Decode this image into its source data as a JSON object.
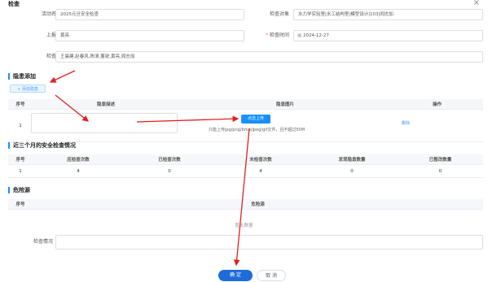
{
  "dialog": {
    "title": "检查",
    "close_icon": "×"
  },
  "form": {
    "activity_name_label": "活动名称",
    "activity_name_value": "2025元旦安全检查",
    "target_label": "检查对象",
    "target_value": "水力学实验室|水工结构室|模型设计|103|阎志加",
    "reporter_label": "上报人",
    "reporter_value": "黄亮",
    "date_label": "检查时间",
    "date_required_mark": "*",
    "date_value": "2024-12-27",
    "inspectors_label": "检查人",
    "inspectors_value": "王晨建,赵春风,陈清,董锐,黄亮,阎志加"
  },
  "hazard_section": {
    "title": "隐患添加",
    "add_button": "+ 添加隐患",
    "columns": [
      "序号",
      "隐患描述",
      "隐患图片",
      "操作"
    ],
    "row": {
      "index": "1",
      "upload_button": "点击上传",
      "upload_hint": "只能上传jpg/png/bmp/jpeg/gif文件，且不超过50M",
      "delete_link": "删除"
    }
  },
  "history_section": {
    "title": "近三个月的安全检查情况",
    "columns": [
      "序号",
      "应检查次数",
      "已检查次数",
      "未检查次数",
      "发现隐患数量",
      "已整改数量"
    ],
    "rows": [
      [
        "1",
        "4",
        "0",
        "4",
        "0",
        "0"
      ]
    ]
  },
  "danger_section": {
    "title": "危险源",
    "columns": [
      "序号",
      "危险源"
    ],
    "empty_text": "暂无数据"
  },
  "remarks": {
    "label": "检查情况",
    "value": ""
  },
  "footer": {
    "ok_label": "确 定",
    "cancel_label": "取 消"
  },
  "colors": {
    "primary": "#1890ff",
    "annotation_red": "#e02020"
  }
}
